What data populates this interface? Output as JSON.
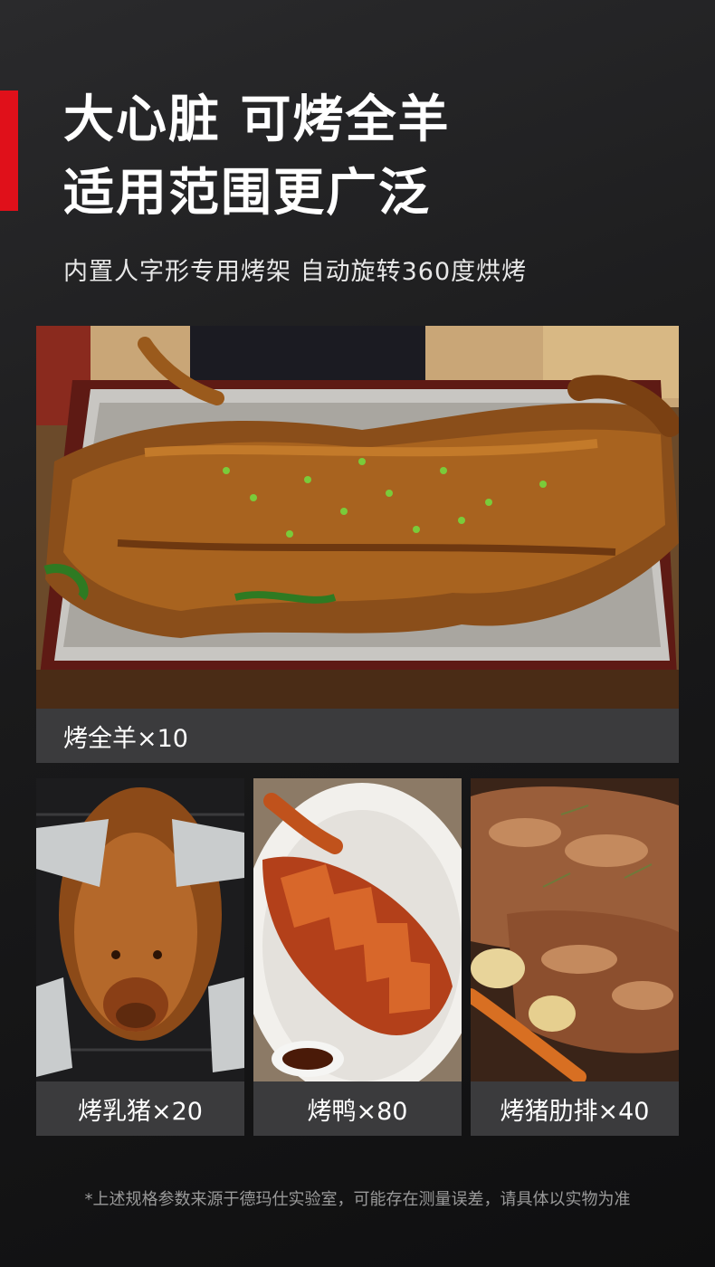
{
  "header": {
    "title_line1": "大心脏 可烤全羊",
    "title_line2": "适用范围更广泛",
    "subtitle": "内置人字形专用烤架 自动旋转360度烘烤",
    "accent_color": "#e0101a"
  },
  "gallery": {
    "main": {
      "caption": "烤全羊×10"
    },
    "items": [
      {
        "caption": "烤乳猪×20"
      },
      {
        "caption": "烤鸭×80"
      },
      {
        "caption": "烤猪肋排×40"
      }
    ]
  },
  "footnote": "*上述规格参数来源于德玛仕实验室，可能存在测量误差，请具体以实物为准"
}
